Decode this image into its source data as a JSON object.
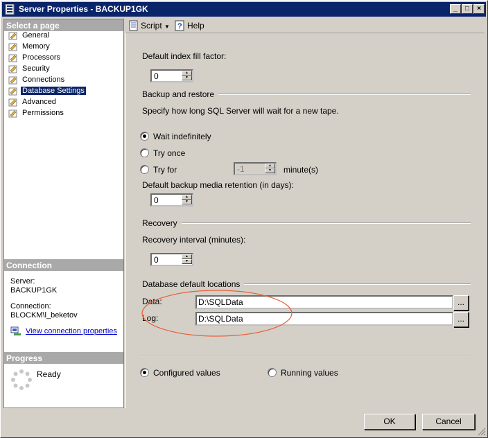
{
  "window": {
    "title": "Server Properties - BACKUP1GK"
  },
  "sidebar": {
    "header": "Select a page",
    "items": [
      {
        "label": "General"
      },
      {
        "label": "Memory"
      },
      {
        "label": "Processors"
      },
      {
        "label": "Security"
      },
      {
        "label": "Connections"
      },
      {
        "label": "Database Settings",
        "selected": true
      },
      {
        "label": "Advanced"
      },
      {
        "label": "Permissions"
      }
    ]
  },
  "connection": {
    "header": "Connection",
    "server_label": "Server:",
    "server_value": "BACKUP1GK",
    "connection_label": "Connection:",
    "connection_value": "BLOCKM\\l_beketov",
    "view_link": "View connection properties"
  },
  "progress": {
    "header": "Progress",
    "status": "Ready"
  },
  "toolbar": {
    "script_label": "Script",
    "help_label": "Help"
  },
  "settings": {
    "fill_factor_label": "Default index fill factor:",
    "fill_factor_value": "0",
    "backup_group": "Backup and restore",
    "backup_desc": "Specify how long SQL Server will wait for a new tape.",
    "wait_indefinitely": "Wait indefinitely",
    "try_once": "Try once",
    "try_for": "Try for",
    "try_for_value": "-1",
    "minutes_unit": "minute(s)",
    "retention_label": "Default backup media retention (in days):",
    "retention_value": "0",
    "recovery_group": "Recovery",
    "recovery_interval_label": "Recovery interval (minutes):",
    "recovery_interval_value": "0",
    "locations_group": "Database default locations",
    "data_label": "Data:",
    "data_value": "D:\\SQLData",
    "log_label": "Log:",
    "log_value": "D:\\SQLData",
    "browse": "...",
    "configured_values": "Configured values",
    "running_values": "Running values"
  },
  "buttons": {
    "ok": "OK",
    "cancel": "Cancel"
  },
  "colors": {
    "titlebar": "#0a246a",
    "selection": "#0a246a",
    "annotation_ellipse": "#e8603a",
    "link": "#0000cc"
  }
}
